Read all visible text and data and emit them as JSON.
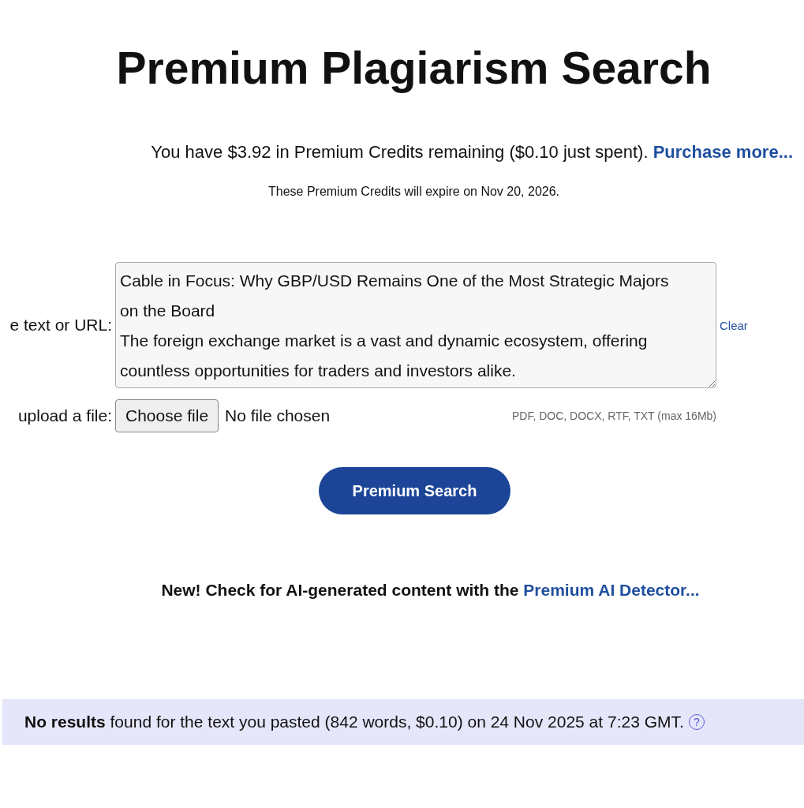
{
  "title": "Premium Plagiarism Search",
  "credits": {
    "text": "You have $3.92 in Premium Credits remaining ($0.10 just spent).",
    "link": "Purchase more..."
  },
  "expiry": "These Premium Credits will expire on Nov 20, 2026.",
  "text_input": {
    "label": "e text or URL:",
    "value": "Cable in Focus: Why GBP/USD Remains One of the Most Strategic Majors on the Board\nThe foreign exchange market is a vast and dynamic ecosystem, offering countless opportunities for traders and investors alike.",
    "clear": "Clear"
  },
  "file_input": {
    "label": "upload a file:",
    "button": "Choose file",
    "status": "No file chosen",
    "hint": "PDF, DOC, DOCX, RTF, TXT (max 16Mb)"
  },
  "search_button": "Premium Search",
  "ai_notice": {
    "text": "New! Check for AI-generated content with the",
    "link": "Premium AI Detector..."
  },
  "result": {
    "text": "**No results** found for the text you pasted (842 words, $0.10) on 24 Nov 2025 at 7:23 GMT.",
    "help": "?"
  }
}
